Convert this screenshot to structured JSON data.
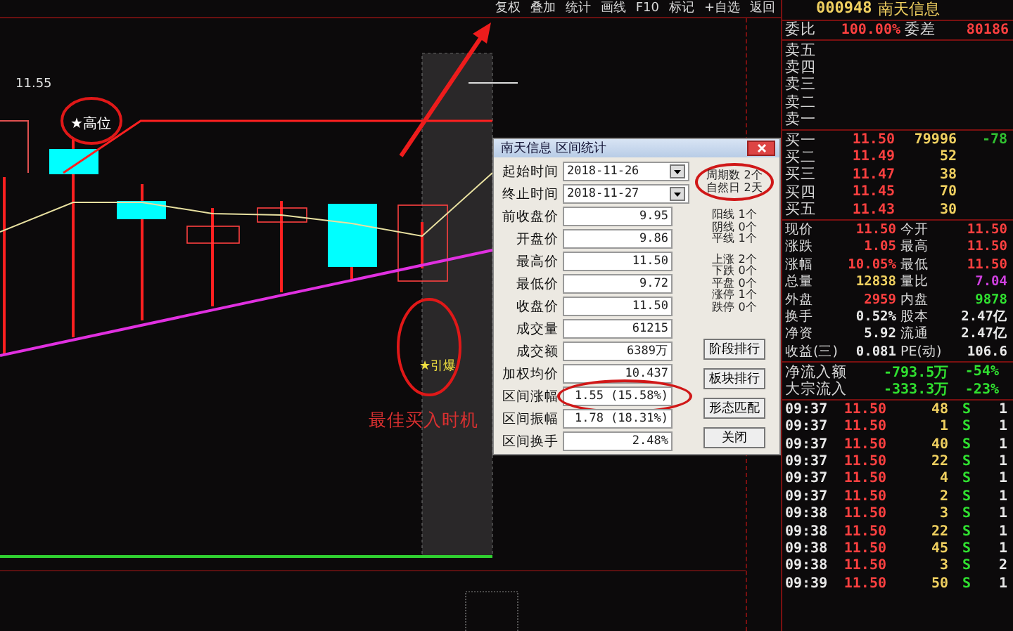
{
  "toolbar": {
    "items": [
      "复权",
      "叠加",
      "统计",
      "画线",
      "F10",
      "标记",
      "+自选",
      "返回"
    ]
  },
  "chart": {
    "high_label": "11.55",
    "annotations": [
      {
        "kind": "tag",
        "text": "★高位"
      },
      {
        "kind": "signal",
        "text": "★引爆"
      },
      {
        "kind": "caption",
        "text": "最佳买入时机"
      }
    ]
  },
  "dialog": {
    "title": "南天信息 区间统计",
    "fields": [
      {
        "kind": "date",
        "label": "起始时间",
        "value": "2018-11-26"
      },
      {
        "kind": "date",
        "label": "终止时间",
        "value": "2018-11-27"
      },
      {
        "kind": "value",
        "label": "前收盘价",
        "value": "9.95"
      },
      {
        "kind": "value",
        "label": "开盘价",
        "value": "9.86"
      },
      {
        "kind": "value",
        "label": "最高价",
        "value": "11.50"
      },
      {
        "kind": "value",
        "label": "最低价",
        "value": "9.72"
      },
      {
        "kind": "value",
        "label": "收盘价",
        "value": "11.50"
      },
      {
        "kind": "value",
        "label": "成交量",
        "value": "61215"
      },
      {
        "kind": "value",
        "label": "成交额",
        "value": "6389万"
      },
      {
        "kind": "value",
        "label": "加权均价",
        "value": "10.437"
      },
      {
        "kind": "value",
        "label": "区间涨幅",
        "value": "1.55 (15.58%)",
        "circled": true
      },
      {
        "kind": "value",
        "label": "区间振幅",
        "value": "1.78 (18.31%)"
      },
      {
        "kind": "value",
        "label": "区间换手",
        "value": "2.48%"
      }
    ],
    "period_stats": [
      {
        "label": "周期数",
        "value": "2个"
      },
      {
        "label": "自然日",
        "value": "2天"
      }
    ],
    "candle_stats": [
      {
        "label": "阳线",
        "value": "1个"
      },
      {
        "label": "阴线",
        "value": "0个"
      },
      {
        "label": "平线",
        "value": "1个"
      }
    ],
    "move_stats": [
      {
        "label": "上涨",
        "value": "2个"
      },
      {
        "label": "下跌",
        "value": "0个"
      },
      {
        "label": "平盘",
        "value": "0个"
      },
      {
        "label": "涨停",
        "value": "1个"
      },
      {
        "label": "跌停",
        "value": "0个"
      }
    ],
    "buttons": [
      "阶段排行",
      "板块排行",
      "形态匹配",
      "关闭"
    ]
  },
  "quote": {
    "code": "000948",
    "name": "南天信息",
    "ratio_label": "委比",
    "ratio": "100.00%",
    "diff_label": "委差",
    "diff": "80186",
    "sell": [
      {
        "label": "卖五"
      },
      {
        "label": "卖四"
      },
      {
        "label": "卖三"
      },
      {
        "label": "卖二"
      },
      {
        "label": "卖一"
      }
    ],
    "buy": [
      {
        "label": "买一",
        "price": "11.50",
        "volume": "79996",
        "change": "-78"
      },
      {
        "label": "买二",
        "price": "11.49",
        "volume": "52"
      },
      {
        "label": "买三",
        "price": "11.47",
        "volume": "38"
      },
      {
        "label": "买四",
        "price": "11.45",
        "volume": "70"
      },
      {
        "label": "买五",
        "price": "11.43",
        "volume": "30"
      }
    ],
    "stats": [
      [
        {
          "label": "现价",
          "value": "11.50",
          "color": "#ff4040"
        },
        {
          "label": "今开",
          "value": "11.50",
          "color": "#ff4040"
        }
      ],
      [
        {
          "label": "涨跌",
          "value": "1.05",
          "color": "#ff4040"
        },
        {
          "label": "最高",
          "value": "11.50",
          "color": "#ff4040"
        }
      ],
      [
        {
          "label": "涨幅",
          "value": "10.05%",
          "color": "#ff4040"
        },
        {
          "label": "最低",
          "value": "11.50",
          "color": "#ff4040"
        }
      ],
      [
        {
          "label": "总量",
          "value": "12838",
          "color": "#f0d060"
        },
        {
          "label": "量比",
          "value": "7.04",
          "color": "#d040e0"
        }
      ],
      [
        {
          "label": "外盘",
          "value": "2959",
          "color": "#ff4040"
        },
        {
          "label": "内盘",
          "value": "9878",
          "color": "#30e030"
        }
      ],
      [
        {
          "label": "换手",
          "value": "0.52%",
          "color": "#e8e8e8"
        },
        {
          "label": "股本",
          "value": "2.47亿",
          "color": "#e8e8e8"
        }
      ],
      [
        {
          "label": "净资",
          "value": "5.92",
          "color": "#e8e8e8"
        },
        {
          "label": "流通",
          "value": "2.47亿",
          "color": "#e8e8e8"
        }
      ],
      [
        {
          "label": "收益(三)",
          "value": "0.081",
          "color": "#e8e8e8"
        },
        {
          "label": "PE(动)",
          "value": "106.6",
          "color": "#e8e8e8"
        }
      ]
    ],
    "flows": [
      {
        "label": "净流入额",
        "value": "-793.5万",
        "percent": "-54%"
      },
      {
        "label": "大宗流入",
        "value": "-333.3万",
        "percent": "-23%"
      }
    ],
    "trades": [
      {
        "time": "09:37",
        "price": "11.50",
        "volume": "48",
        "side": "S",
        "count": "1"
      },
      {
        "time": "09:37",
        "price": "11.50",
        "volume": "1",
        "side": "S",
        "count": "1"
      },
      {
        "time": "09:37",
        "price": "11.50",
        "volume": "40",
        "side": "S",
        "count": "1"
      },
      {
        "time": "09:37",
        "price": "11.50",
        "volume": "22",
        "side": "S",
        "count": "1"
      },
      {
        "time": "09:37",
        "price": "11.50",
        "volume": "4",
        "side": "S",
        "count": "1"
      },
      {
        "time": "09:37",
        "price": "11.50",
        "volume": "2",
        "side": "S",
        "count": "1"
      },
      {
        "time": "09:38",
        "price": "11.50",
        "volume": "3",
        "side": "S",
        "count": "1"
      },
      {
        "time": "09:38",
        "price": "11.50",
        "volume": "22",
        "side": "S",
        "count": "1"
      },
      {
        "time": "09:38",
        "price": "11.50",
        "volume": "45",
        "side": "S",
        "count": "1"
      },
      {
        "time": "09:38",
        "price": "11.50",
        "volume": "3",
        "side": "S",
        "count": "2"
      },
      {
        "time": "09:39",
        "price": "11.50",
        "volume": "50",
        "side": "S",
        "count": "1"
      }
    ]
  }
}
